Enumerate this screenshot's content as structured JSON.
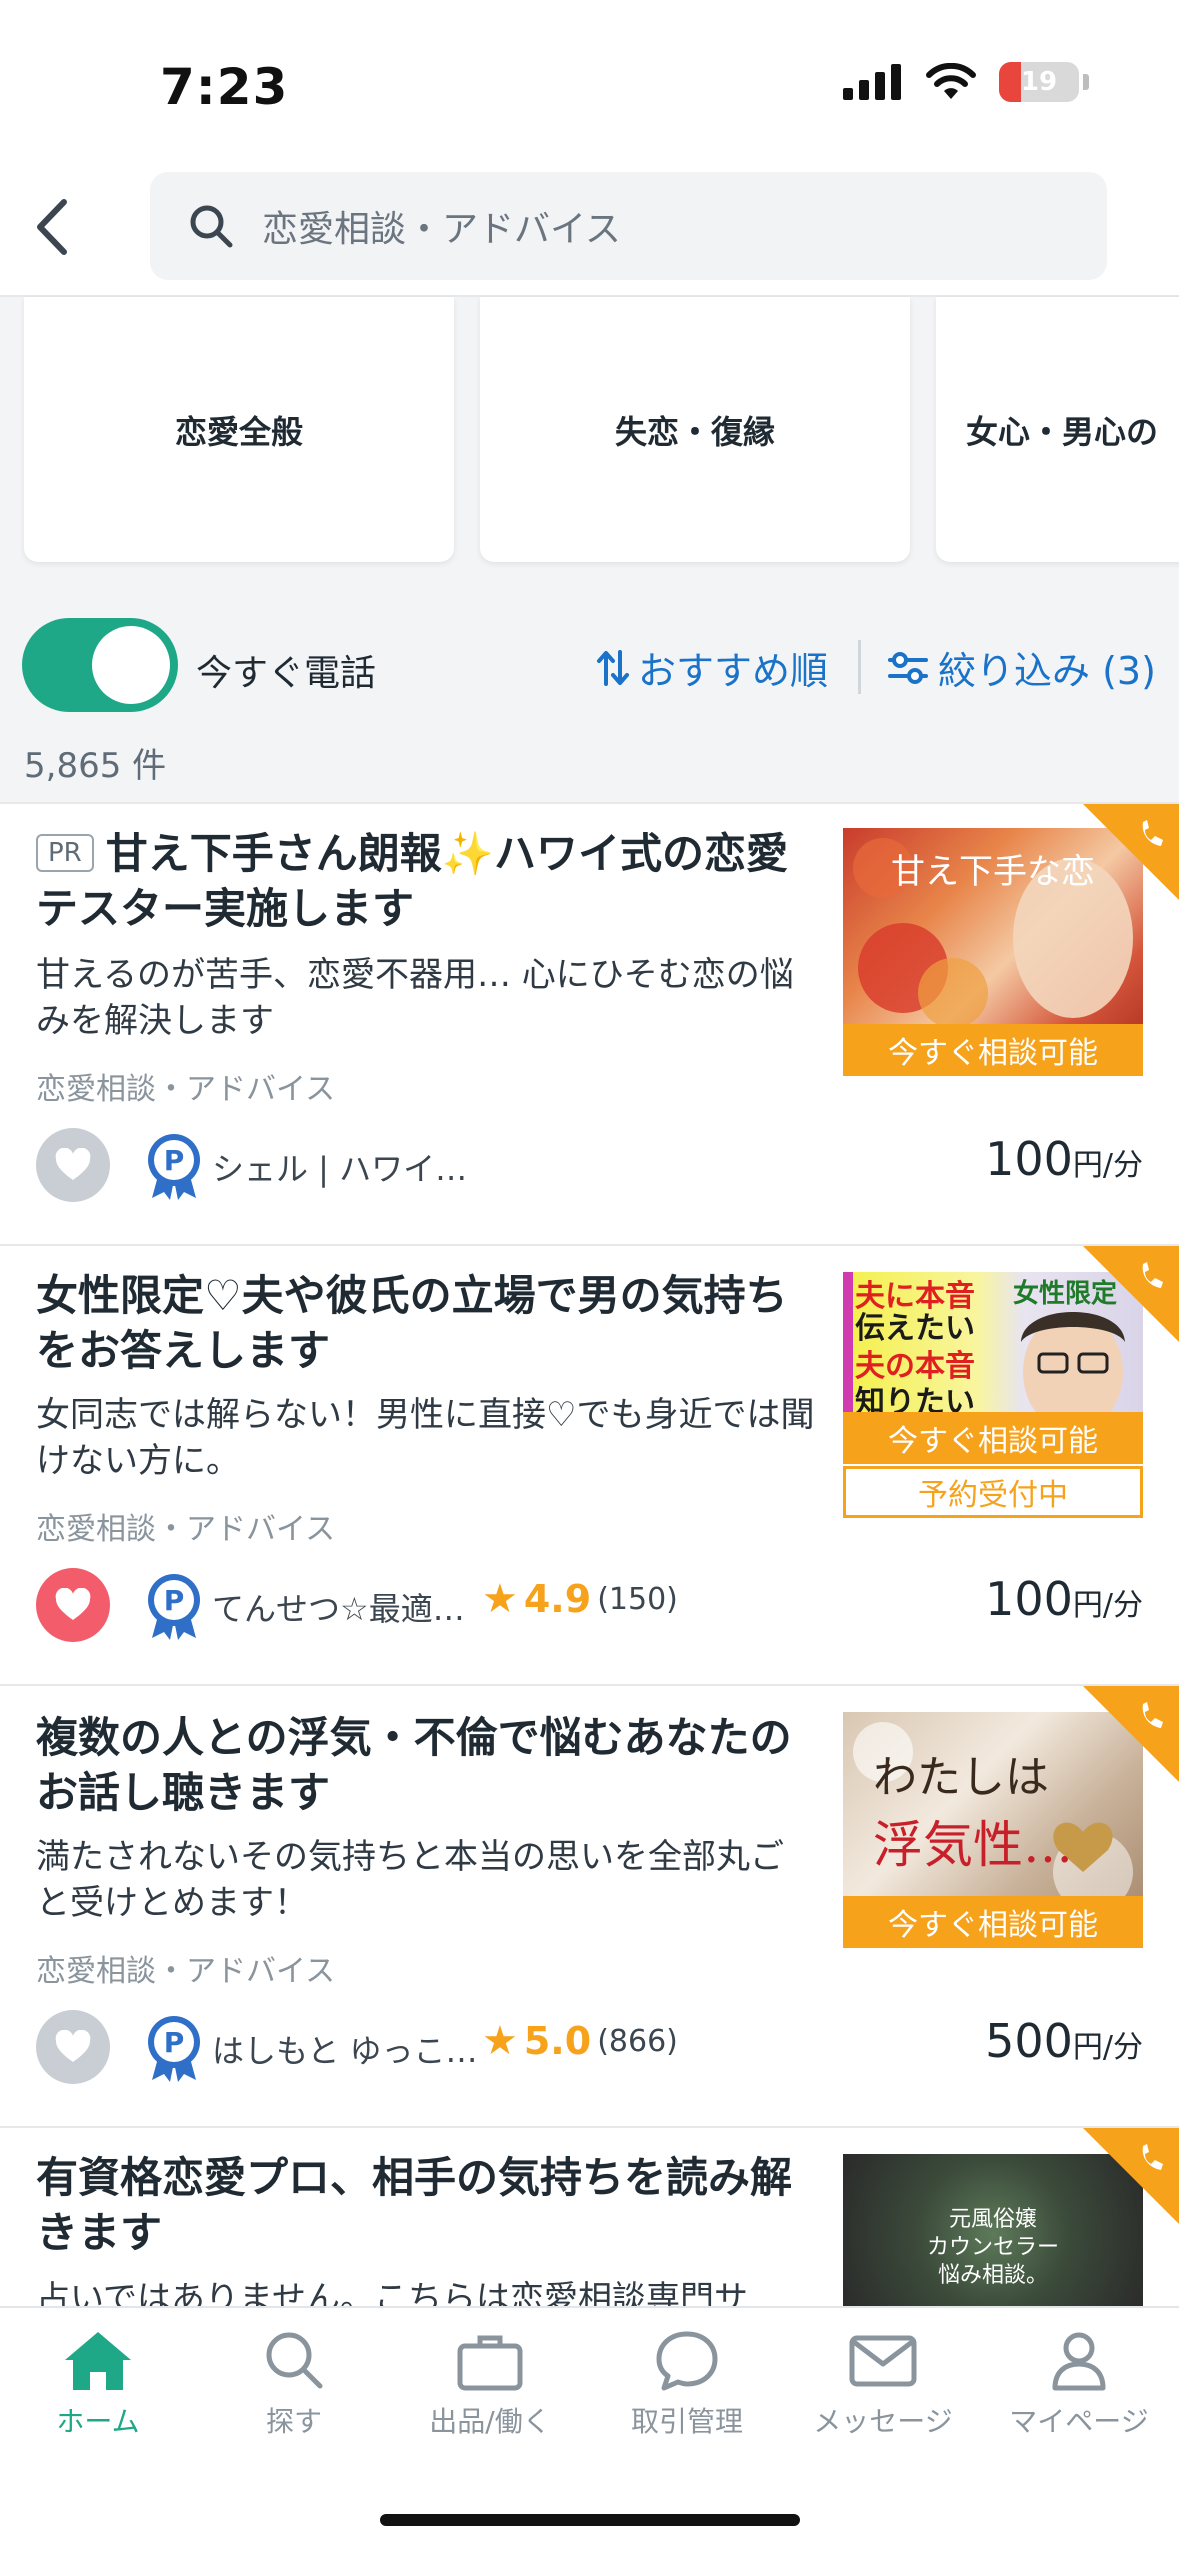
{
  "status_bar": {
    "time": "7:23",
    "battery": "19"
  },
  "header": {
    "search_placeholder": "恋愛相談・アドバイス"
  },
  "categories": [
    "恋愛全般",
    "失恋・復縁",
    "女心・男心の"
  ],
  "filter": {
    "toggle_label": "今すぐ電話",
    "sort_label": "おすすめ順",
    "filter_label": "絞り込み (3)",
    "count": "5,865 件"
  },
  "listings": [
    {
      "pr": "PR",
      "title": "甘え下手さん朗報✨ハワイ式の恋愛テスター実施します",
      "description": "甘えるのが苦手、恋愛不器用… 心にひそむ恋の悩みを解決します",
      "category": "恋愛相談・アドバイス",
      "seller": "シェル | ハワイ…",
      "price": "100",
      "price_unit": "円/分",
      "thumb_text": "甘え下手な恋",
      "availability": "今すぐ相談可能",
      "favorited": false
    },
    {
      "title": "女性限定♡夫や彼氏の立場で男の気持ちをお答えします",
      "description": "女同志では解らない！男性に直接♡でも身近では聞けない方に。",
      "category": "恋愛相談・アドバイス",
      "seller": "てんせつ☆最適…",
      "rating": "4.9",
      "reviews": "(150)",
      "price": "100",
      "price_unit": "円/分",
      "thumb_text_1": "夫に本音",
      "thumb_text_2": "伝えたい",
      "thumb_text_3": "夫の本音",
      "thumb_text_4": "知りたい",
      "thumb_text_5": "女性限定",
      "availability": "今すぐ相談可能",
      "reservation": "予約受付中",
      "favorited": true
    },
    {
      "title": "複数の人との浮気・不倫で悩むあなたのお話し聴きます",
      "description": "満たされないその気持ちと本当の思いを全部丸ごと受けとめます！",
      "category": "恋愛相談・アドバイス",
      "seller": "はしもと ゆっこ…",
      "rating": "5.0",
      "reviews": "(866)",
      "price": "500",
      "price_unit": "円/分",
      "thumb_text_1": "わたしは",
      "thumb_text_2": "浮気性…",
      "availability": "今すぐ相談可能",
      "favorited": false
    },
    {
      "title": "有資格恋愛プロ、相手の気持ちを読み解きます",
      "description": "占いではありません。こちらは恋愛相談専門サ",
      "thumb_text_1": "元風俗嬢",
      "thumb_text_2": "カウンセラー",
      "thumb_text_3": "悩み相談。"
    }
  ],
  "tabs": [
    {
      "label": "ホーム",
      "icon": "home-icon",
      "active": true
    },
    {
      "label": "探す",
      "icon": "search-icon"
    },
    {
      "label": "出品/働く",
      "icon": "briefcase-icon"
    },
    {
      "label": "取引管理",
      "icon": "chat-icon"
    },
    {
      "label": "メッセージ",
      "icon": "mail-icon"
    },
    {
      "label": "マイページ",
      "icon": "person-icon"
    }
  ],
  "colors": {
    "accent": "#1ea887",
    "link": "#1a73c8",
    "orange": "#f7a21b",
    "heart_on": "#f35d6b"
  }
}
